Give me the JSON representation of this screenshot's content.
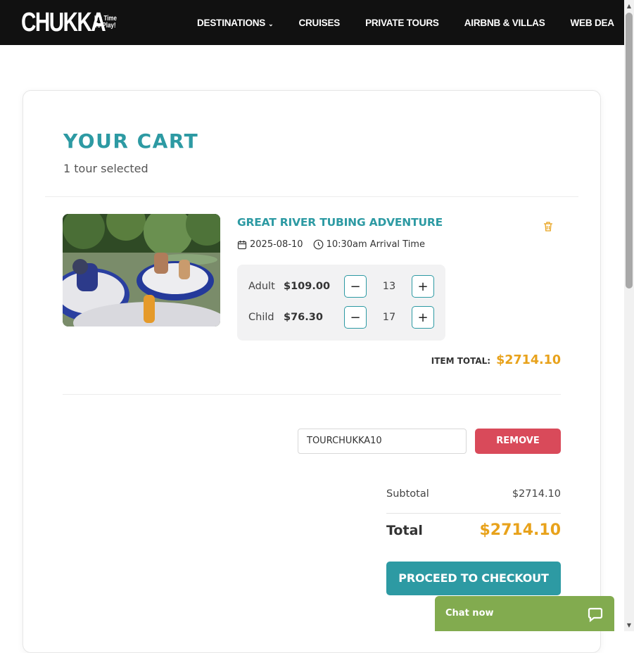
{
  "brand": {
    "name": "CHUKKA",
    "tagline": "It's Time To Play!"
  },
  "nav": {
    "items": [
      {
        "label": "DESTINATIONS",
        "has_dropdown": true
      },
      {
        "label": "CRUISES"
      },
      {
        "label": "PRIVATE TOURS"
      },
      {
        "label": "AIRBNB & VILLAS"
      },
      {
        "label": "WEB DEA"
      }
    ]
  },
  "cart": {
    "title": "YOUR CART",
    "subtitle": "1 tour selected",
    "item": {
      "name": "GREAT RIVER TUBING ADVENTURE",
      "date": "2025-08-10",
      "time": "10:30am Arrival Time",
      "tickets": [
        {
          "label": "Adult",
          "price": "$109.00",
          "quantity": "13"
        },
        {
          "label": "Child",
          "price": "$76.30",
          "quantity": "17"
        }
      ],
      "total_label": "ITEM TOTAL:",
      "total_value": "$2714.10"
    },
    "promo": {
      "code": "TOURCHUKKA10",
      "remove_label": "REMOVE"
    },
    "summary": {
      "subtotal_label": "Subtotal",
      "subtotal_value": "$2714.10",
      "total_label": "Total",
      "total_value": "$2714.10"
    },
    "checkout_label": "PROCEED TO CHECKOUT"
  },
  "chat": {
    "label": "Chat now"
  },
  "colors": {
    "accent": "#2d9aa3",
    "price": "#e8a21b",
    "danger": "#d94a5a",
    "chat": "#82ab4f",
    "nav_bg": "#111111"
  }
}
